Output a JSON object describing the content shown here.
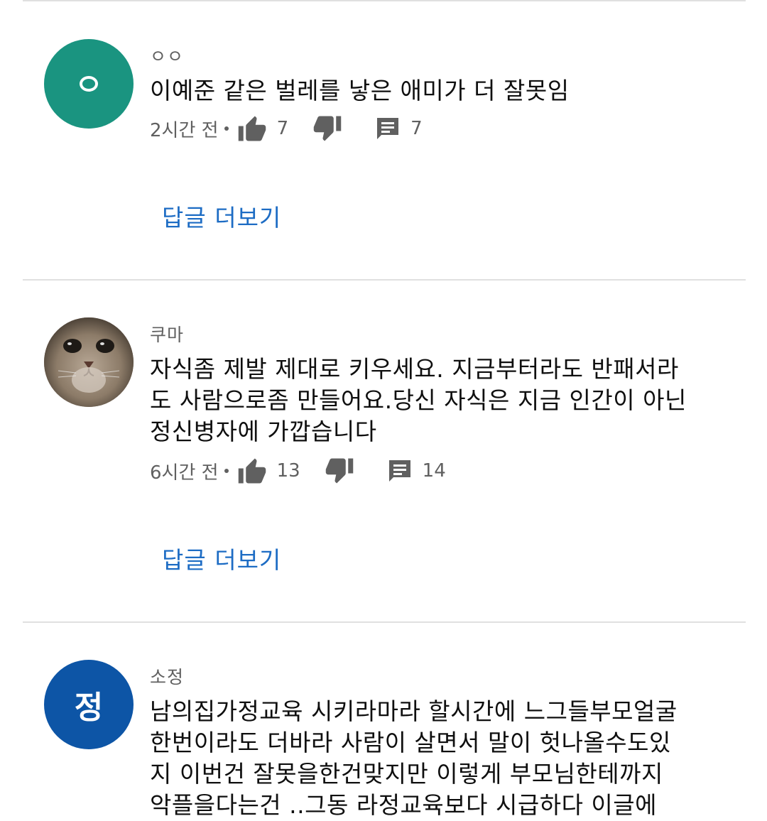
{
  "comments": [
    {
      "author": "ㅇㅇ",
      "avatar_letter": "ㅇ",
      "avatar_color": "#1a9480",
      "body": "이예준 같은 벌레를 낳은 애미가 더 잘못임",
      "time": "2시간 전",
      "likes": "7",
      "replies_count": "7",
      "more_replies": "답글 더보기"
    },
    {
      "author": "쿠마",
      "avatar_letter": "",
      "avatar_color": "#8a7a68",
      "body": "자식좀 제발 제대로 키우세요. 지금부터라도 반패서라\n도 사람으로좀 만들어요.당신 자식은 지금 인간이 아닌\n정신병자에 가깝습니다",
      "time": "6시간 전",
      "likes": "13",
      "replies_count": "14",
      "more_replies": "답글 더보기"
    },
    {
      "author": "소정",
      "avatar_letter": "정",
      "avatar_color": "#0d55a6",
      "body": "남의집가정교육 시키라마라 할시간에 느그들부모얼굴\n한번이라도 더바라 사람이 살면서 말이 헛나올수도있\n지 이번건 잘못을한건맞지만 이렇게 부모님한테까지\n악플을다는건 ..그동 라정교육보다 시급하다 이글에"
    }
  ],
  "icons": {
    "like": "thumbs-up-icon",
    "dislike": "thumbs-down-icon",
    "reply": "comment-icon"
  }
}
